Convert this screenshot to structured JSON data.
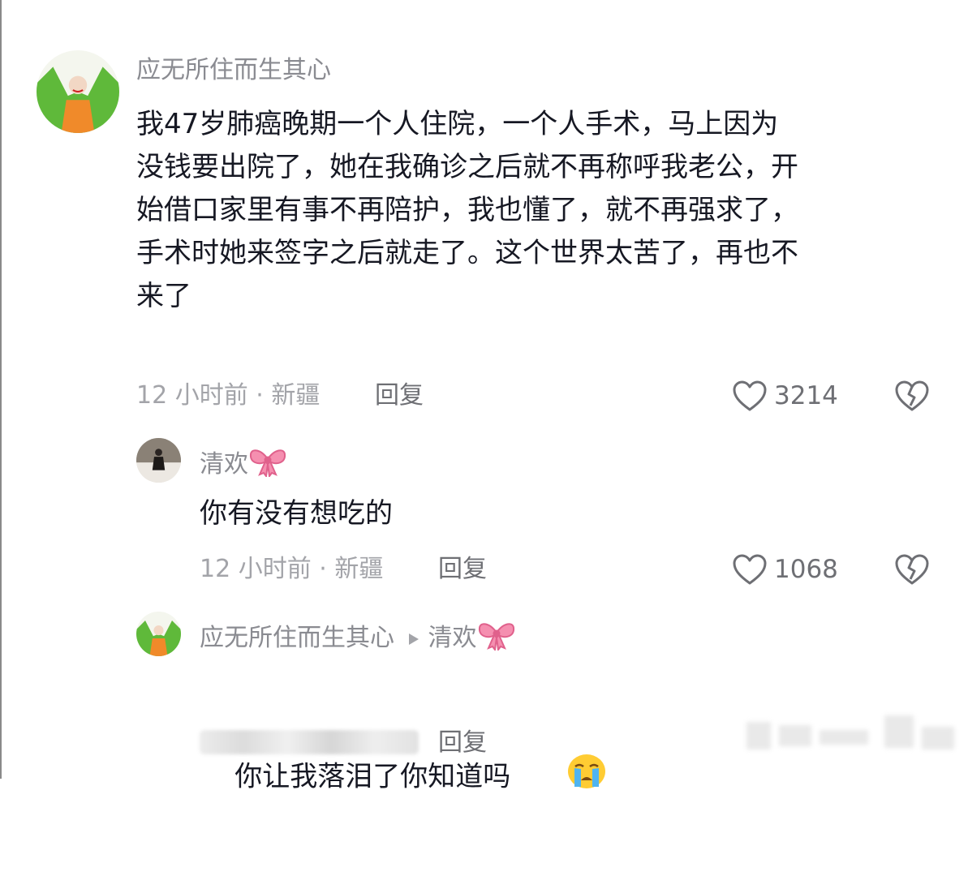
{
  "comments": [
    {
      "username": "应无所住而生其心",
      "content": "我47岁肺癌晚期一个人住院，一个人手术，马上因为\n没钱要出院了，她在我确诊之后就不再称呼我老公，开\n始借口家里有事不再陪护，我也懂了，就不再强求了，\n手术时她来签字之后就走了。这个世界太苦了，再也不\n来了",
      "meta": "12 小时前 · 新疆",
      "reply_label": "回复",
      "likes": "3214",
      "avatar_icon": "joker-avatar"
    },
    {
      "username": "清欢",
      "username_emoji": "pink-bow-icon",
      "content": "你有没有想吃的",
      "meta": "12 小时前 · 新疆",
      "reply_label": "回复",
      "likes": "1068",
      "avatar_icon": "person-avatar"
    },
    {
      "username": "应无所住而生其心",
      "reply_to": "清欢",
      "username_emoji": "pink-bow-icon",
      "content": "你让我落泪了你知道吗",
      "content_emoji": "crying-face-icon",
      "reply_label": "回复",
      "avatar_icon": "joker-avatar"
    }
  ],
  "colors": {
    "text": "#161823",
    "username": "#8a8b91",
    "meta": "#a3a4a9",
    "icon": "#6e6f74"
  }
}
